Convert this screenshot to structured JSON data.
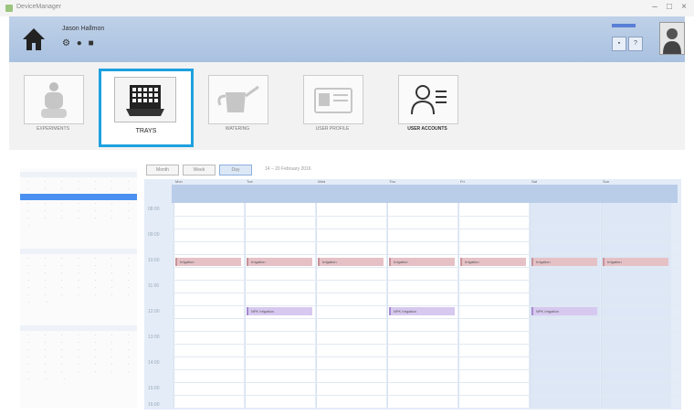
{
  "window": {
    "title": "DeviceManager",
    "controls": [
      "–",
      "□",
      "×"
    ]
  },
  "header": {
    "org_name": "Jason Hallmon",
    "icons": [
      "gear-icon",
      "bell-icon",
      "tray-icon"
    ]
  },
  "nav": {
    "tiles": [
      {
        "label": "EXPERIMENTS"
      },
      {
        "label": "TRAYS"
      },
      {
        "label": "WATERING"
      },
      {
        "label": "USER PROFILE"
      },
      {
        "label": "USER ACCOUNTS"
      }
    ]
  },
  "views": {
    "buttons": [
      "Month",
      "Week",
      "Day"
    ],
    "range": "14 – 20 February 2016"
  },
  "calendar": {
    "days": [
      "Mon",
      "Tue",
      "Wed",
      "Thu",
      "Fri",
      "Sat",
      "Sun"
    ],
    "times": [
      "08:00",
      "09:00",
      "10:00",
      "11:00",
      "12:00",
      "13:00",
      "14:00",
      "15:00",
      "16:00"
    ],
    "events": {
      "irrigation": "Irrigation",
      "fertilization": "NPK Irrigation"
    }
  }
}
